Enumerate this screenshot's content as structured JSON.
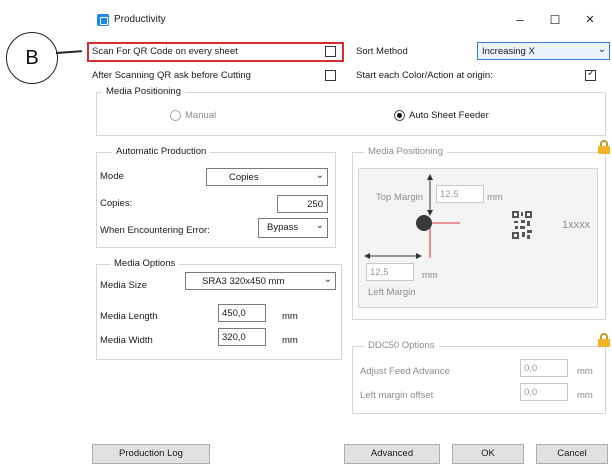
{
  "callout": {
    "letter": "B"
  },
  "window": {
    "title": "Productivity",
    "minimize": "–",
    "maximize": "☐",
    "close": "✕"
  },
  "top": {
    "scan_qr_label": "Scan For QR Code on every sheet",
    "scan_qr_checked": false,
    "after_scan_label": "After Scanning QR ask before Cutting",
    "after_scan_checked": false,
    "sort_method_label": "Sort Method",
    "sort_method_value": "Increasing X",
    "start_origin_label": "Start each Color/Action at origin:",
    "start_origin_checked": true
  },
  "media_positioning_top": {
    "title": "Media Positioning",
    "manual_label": "Manual",
    "auto_label": "Auto Sheet Feeder",
    "selected": "auto"
  },
  "automatic_production": {
    "title": "Automatic Production",
    "mode_label": "Mode",
    "mode_value": "Copies",
    "copies_label": "Copies:",
    "copies_value": "250",
    "error_label": "When Encountering Error:",
    "error_value": "Bypass"
  },
  "media_options": {
    "title": "Media Options",
    "size_label": "Media Size",
    "size_value": "SRA3 320x450 mm",
    "length_label": "Media Length",
    "length_value": "450,0",
    "length_unit": "mm",
    "width_label": "Media Width",
    "width_value": "320,0",
    "width_unit": "mm"
  },
  "media_positioning_right": {
    "title": "Media Positioning",
    "top_margin_label": "Top Margin",
    "top_margin_value": "12,5",
    "top_margin_unit": "mm",
    "left_margin_value": "12,5",
    "left_margin_unit": "mm",
    "left_margin_label": "Left Margin",
    "qr_text": "1xxxx"
  },
  "ddc50": {
    "title": "DDC50 Options",
    "feed_label": "Adjust Feed Advance",
    "feed_value": "0,0",
    "feed_unit": "mm",
    "left_offset_label": "Left margin offset",
    "left_offset_value": "0,0",
    "left_offset_unit": "mm"
  },
  "buttons": {
    "production_log": "Production Log",
    "advanced": "Advanced",
    "ok": "OK",
    "cancel": "Cancel"
  },
  "colors": {
    "highlight": "#d32f2f",
    "lock": "#f0b429",
    "select_accent": "#3a7bd5"
  }
}
